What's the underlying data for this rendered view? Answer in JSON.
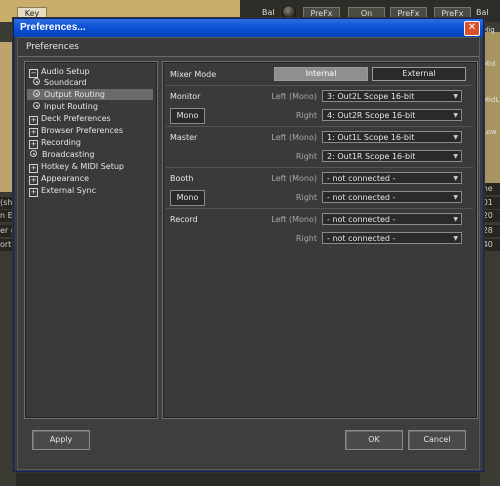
{
  "background": {
    "key_label": "Key",
    "bal_label_1": "Bal",
    "bal_label_2": "Bal",
    "buttons": [
      "PreFx",
      "On",
      "PreFx",
      "PreFx"
    ],
    "right_labels": [
      "Hig",
      "Mid",
      "MidL",
      "Low"
    ],
    "right_rows": [
      "me",
      ":01",
      ":20",
      ":28",
      ":40"
    ],
    "left_rows": [
      "(she",
      "n Ex",
      "er (E",
      "ort '"
    ]
  },
  "dialog": {
    "title": "Preferences...",
    "close_glyph": "✕",
    "header": "Preferences"
  },
  "tree": [
    {
      "label": "Audio Setup",
      "type": "minus"
    },
    {
      "label": "Soundcard",
      "type": "bullet"
    },
    {
      "label": "Output Routing",
      "type": "bullet",
      "selected": true
    },
    {
      "label": "Input Routing",
      "type": "bullet"
    },
    {
      "label": "Deck Preferences",
      "type": "plus"
    },
    {
      "label": "Browser Preferences",
      "type": "plus"
    },
    {
      "label": "Recording",
      "type": "plus"
    },
    {
      "label": "Broadcasting",
      "type": "bullet"
    },
    {
      "label": "Hotkey & MIDI Setup",
      "type": "plus"
    },
    {
      "label": "Appearance",
      "type": "plus"
    },
    {
      "label": "External Sync",
      "type": "plus"
    }
  ],
  "routing": {
    "mixer_mode_label": "Mixer Mode",
    "mode_internal": "Internal",
    "mode_external": "External",
    "monitor_label": "Monitor",
    "monitor_left_side": "Left (Mono)",
    "monitor_right_side": "Right",
    "monitor_left_value": "3: Out2L Scope 16-bit",
    "monitor_right_value": "4: Out2R Scope 16-bit",
    "mono_label": "Mono",
    "master_label": "Master",
    "master_left_side": "Left (Mono)",
    "master_right_side": "Right",
    "master_left_value": "1: Out1L Scope 16-bit",
    "master_right_value": "2: Out1R Scope 16-bit",
    "booth_label": "Booth",
    "booth_left_side": "Left (Mono)",
    "booth_right_side": "Right",
    "booth_left_value": "- not connected -",
    "booth_right_value": "- not connected -",
    "booth_mono_label": "Mono",
    "record_label": "Record",
    "record_left_side": "Left (Mono)",
    "record_right_side": "Right",
    "record_left_value": "- not connected -",
    "record_right_value": "- not connected -",
    "dropdown_glyph": "▼"
  },
  "footer": {
    "apply": "Apply",
    "ok": "OK",
    "cancel": "Cancel"
  }
}
